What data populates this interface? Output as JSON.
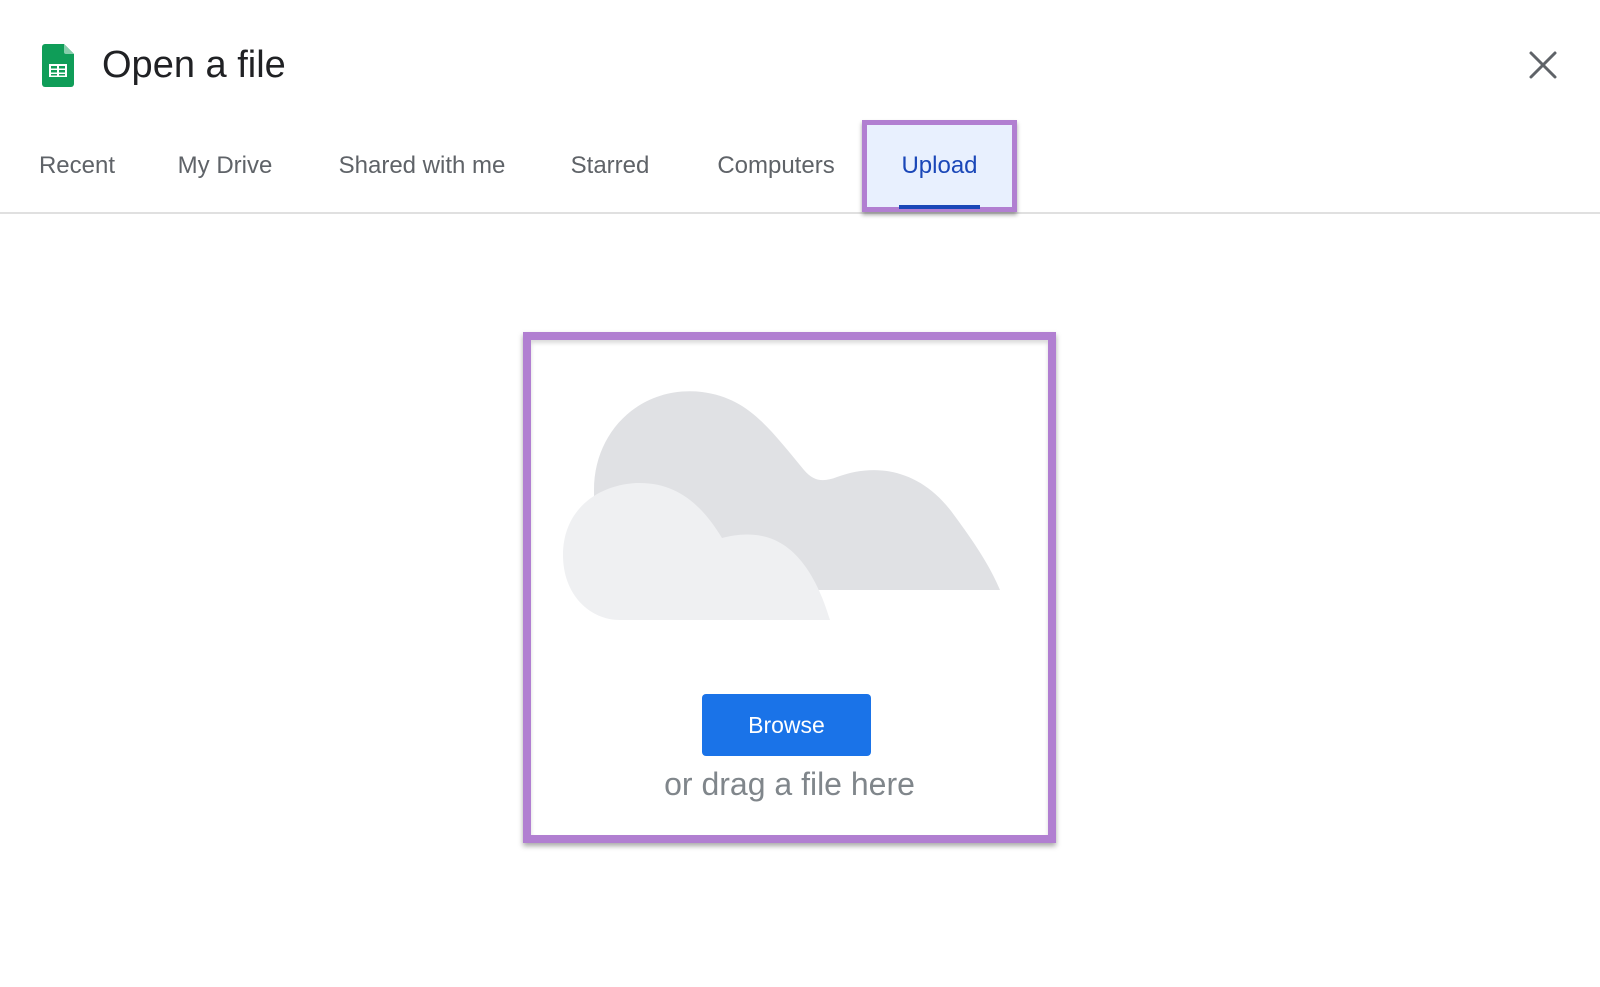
{
  "dialog": {
    "title": "Open a file",
    "app_icon": "google-sheets-icon",
    "close_icon": "close-icon"
  },
  "tabs": [
    {
      "label": "Recent",
      "active": false
    },
    {
      "label": "My Drive",
      "active": false
    },
    {
      "label": "Shared with me",
      "active": false
    },
    {
      "label": "Starred",
      "active": false
    },
    {
      "label": "Computers",
      "active": false
    },
    {
      "label": "Upload",
      "active": true
    }
  ],
  "upload": {
    "illustration_icon": "cloud-upload-illustration",
    "browse_label": "Browse",
    "drag_hint": "or drag a file here"
  },
  "colors": {
    "sheets_green": "#0f9d58",
    "accent_blue": "#1a73e8",
    "active_tab_text": "#1a47b8",
    "active_tab_bg": "#e8f0fe",
    "highlight_purple": "#b17fd1",
    "cloud_back": "#e0e1e4",
    "cloud_front": "#eff0f2"
  }
}
